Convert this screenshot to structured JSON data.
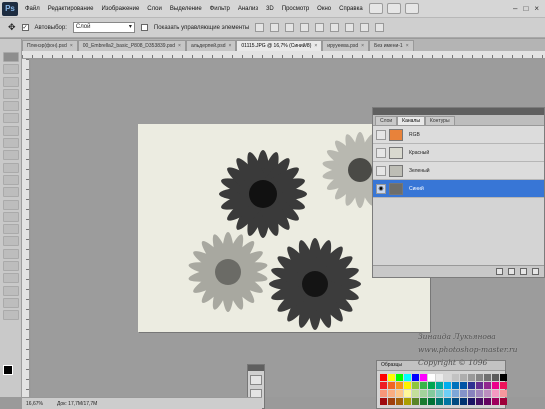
{
  "app": {
    "logo": "Ps"
  },
  "menu": {
    "items": [
      "Файл",
      "Редактирование",
      "Изображение",
      "Слои",
      "Выделение",
      "Фильтр",
      "Анализ",
      "3D",
      "Просмотр",
      "Окно",
      "Справка"
    ],
    "window_controls": [
      "–",
      "□",
      "×"
    ]
  },
  "options": {
    "autoselect_label": "Автовыбор:",
    "autoselect_value": "Слой",
    "show_controls_label": "Показать управляющие элементы"
  },
  "tabs": [
    {
      "label": "Пленэр(фон).psd",
      "active": false
    },
    {
      "label": "00_Embrella2_basic_P808_D353839.psd",
      "active": false
    },
    {
      "label": "альдерпей.psd",
      "active": false
    },
    {
      "label": "01115.JPG @ 16,7% (Синий/8)",
      "active": true
    },
    {
      "label": "ирууеева.psd",
      "active": false
    },
    {
      "label": "Без имени-1",
      "active": false
    }
  ],
  "channels_panel": {
    "tabs": [
      {
        "label": "Слои",
        "active": false
      },
      {
        "label": "Каналы",
        "active": true
      },
      {
        "label": "Контуры",
        "active": false
      }
    ],
    "rows": [
      {
        "name": "RGB",
        "visible": false,
        "selected": false,
        "thumb_color": "#e8823a"
      },
      {
        "name": "Красный",
        "visible": false,
        "selected": false,
        "thumb_color": "#d9d9cf"
      },
      {
        "name": "Зеленый",
        "visible": false,
        "selected": false,
        "thumb_color": "#bdbdb5"
      },
      {
        "name": "Синий",
        "visible": true,
        "selected": true,
        "thumb_color": "#6e6e6a"
      }
    ],
    "eye_glyph": "◉"
  },
  "swatches_panel": {
    "title": "Образцы",
    "colors": [
      "#ff0000",
      "#ffff00",
      "#00ff00",
      "#00ffff",
      "#0000ff",
      "#ff00ff",
      "#ffffff",
      "#ebebeb",
      "#d6d6d6",
      "#c2c2c2",
      "#adadad",
      "#999999",
      "#858585",
      "#707070",
      "#5c5c5c",
      "#000000",
      "#ee1d24",
      "#f26522",
      "#f7941d",
      "#fff200",
      "#8dc63f",
      "#39b54a",
      "#00a651",
      "#00a99d",
      "#00aeef",
      "#0072bc",
      "#0054a6",
      "#2e3192",
      "#662d91",
      "#92278f",
      "#ec008c",
      "#ed145b",
      "#f7977a",
      "#f9ad81",
      "#fdc68a",
      "#fff79a",
      "#c4df9b",
      "#a3d39c",
      "#82ca9d",
      "#7bcdc8",
      "#6ecff6",
      "#7ea7d8",
      "#8493ca",
      "#8882be",
      "#a187be",
      "#bc8dbf",
      "#f49ac2",
      "#f6989d",
      "#9e0b0f",
      "#a0410d",
      "#a36209",
      "#aba000",
      "#598527",
      "#1a7b30",
      "#007236",
      "#00746b",
      "#0076a3",
      "#004a80",
      "#003471",
      "#1b1464",
      "#440e62",
      "#630460",
      "#9e005d",
      "#9e0039"
    ]
  },
  "status": {
    "zoom": "16,67%",
    "doc": "Док: 17,7М/17,7М"
  },
  "watermark": [
    "Зинаида Лукьянова",
    "www.photoshop-master.ru",
    "Copyright © 1096"
  ]
}
